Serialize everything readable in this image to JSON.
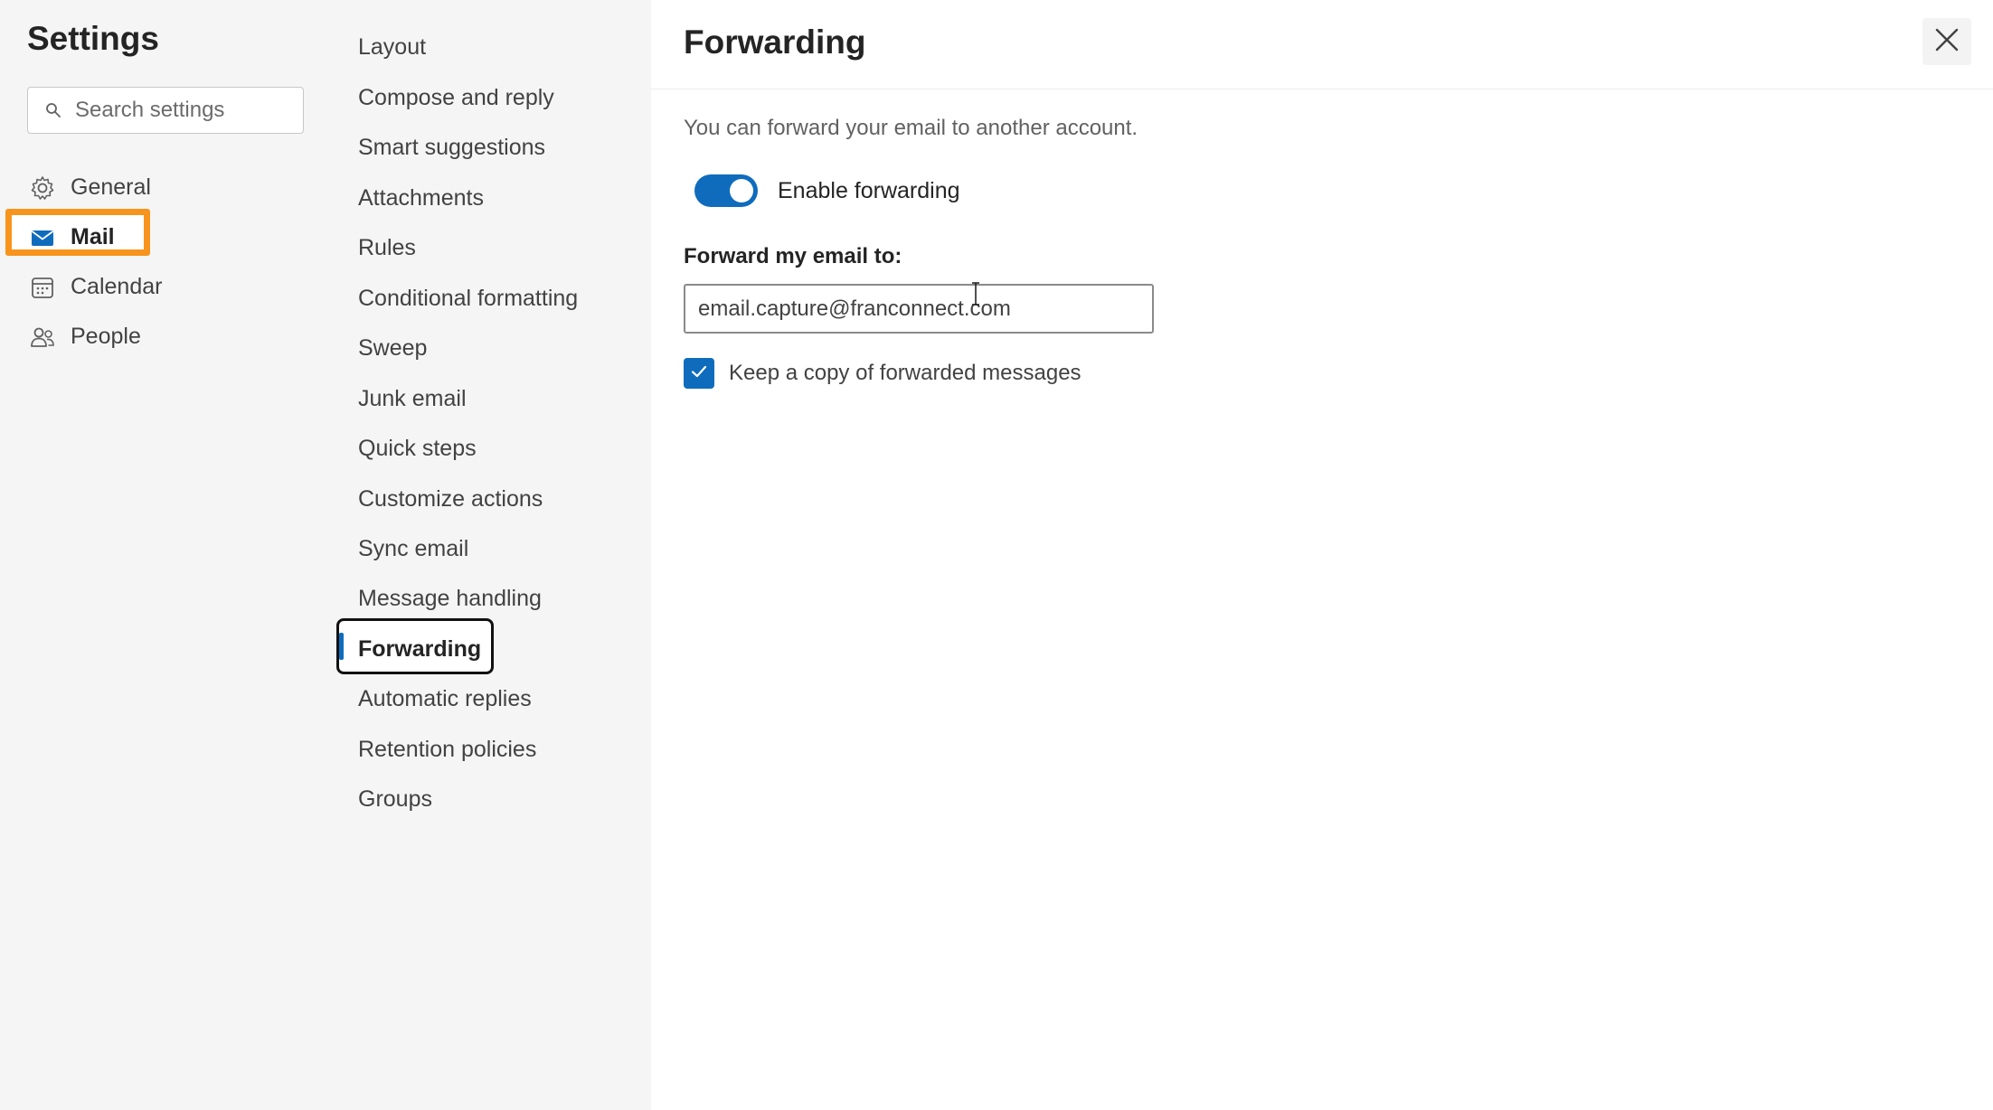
{
  "settings": {
    "title": "Settings",
    "search_placeholder": "Search settings"
  },
  "nav": {
    "items": [
      {
        "label": "General",
        "icon": "gear-icon"
      },
      {
        "label": "Mail",
        "icon": "mail-icon",
        "active": true
      },
      {
        "label": "Calendar",
        "icon": "calendar-icon"
      },
      {
        "label": "People",
        "icon": "people-icon"
      }
    ]
  },
  "mail_menu": {
    "items": [
      "Layout",
      "Compose and reply",
      "Smart suggestions",
      "Attachments",
      "Rules",
      "Conditional formatting",
      "Sweep",
      "Junk email",
      "Quick steps",
      "Customize actions",
      "Sync email",
      "Message handling",
      "Forwarding",
      "Automatic replies",
      "Retention policies",
      "Groups"
    ],
    "selected": "Forwarding"
  },
  "forwarding": {
    "title": "Forwarding",
    "description": "You can forward your email to another account.",
    "toggle_label": "Enable forwarding",
    "toggle_on": true,
    "field_label": "Forward my email to:",
    "email_value": "email.capture@franconnect.com",
    "keep_copy_label": "Keep a copy of forwarded messages",
    "keep_copy_checked": true
  },
  "colors": {
    "accent": "#0f6cbd",
    "highlight": "#f7941d"
  }
}
